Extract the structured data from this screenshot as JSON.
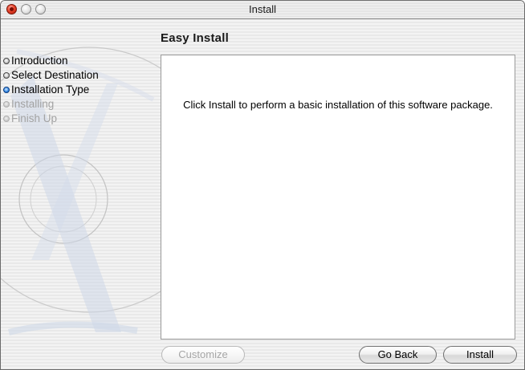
{
  "window": {
    "title": "Install"
  },
  "steps": [
    {
      "label": "Introduction",
      "state": "done"
    },
    {
      "label": "Select Destination",
      "state": "done"
    },
    {
      "label": "Installation Type",
      "state": "current"
    },
    {
      "label": "Installing",
      "state": "pending"
    },
    {
      "label": "Finish Up",
      "state": "pending"
    }
  ],
  "main": {
    "section_title": "Easy Install",
    "message": "Click Install to perform a basic installation of this software package."
  },
  "buttons": {
    "customize": "Customize",
    "go_back": "Go Back",
    "install": "Install"
  },
  "colors": {
    "close_button": "#e8432b",
    "current_step_bullet": "#3a8ee8",
    "pending_step_text": "#a3a3a3",
    "disabled_button_text": "#a6a6a6"
  }
}
